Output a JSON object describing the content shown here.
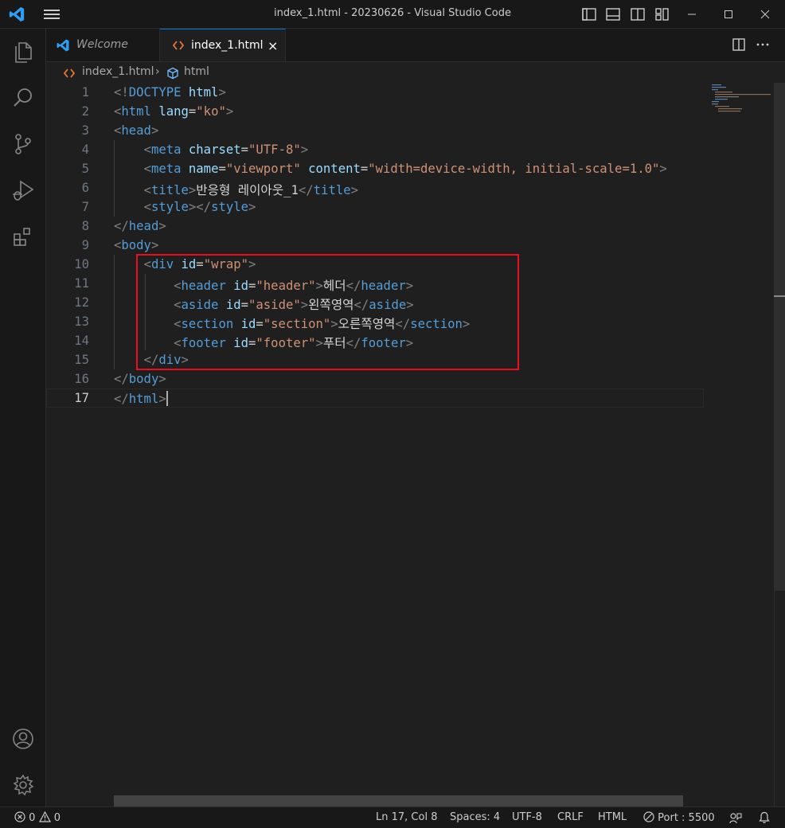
{
  "window": {
    "title": "index_1.html - 20230626 - Visual Studio Code"
  },
  "tabs": [
    {
      "label": "Welcome",
      "active": false
    },
    {
      "label": "index_1.html",
      "active": true,
      "close": "×"
    }
  ],
  "breadcrumb": {
    "file": "index_1.html",
    "separator": "›",
    "symbol": "html"
  },
  "editor": {
    "line_numbers": [
      "1",
      "2",
      "3",
      "4",
      "5",
      "6",
      "7",
      "8",
      "9",
      "10",
      "11",
      "12",
      "13",
      "14",
      "15",
      "16",
      "17"
    ],
    "active_line": "17",
    "lines": [
      [
        [
          "br",
          "<!"
        ],
        [
          "tag",
          "DOCTYPE"
        ],
        [
          "txt",
          " "
        ],
        [
          "attr",
          "html"
        ],
        [
          "br",
          ">"
        ]
      ],
      [
        [
          "br",
          "<"
        ],
        [
          "tag",
          "html"
        ],
        [
          "txt",
          " "
        ],
        [
          "attr",
          "lang"
        ],
        [
          "eq",
          "="
        ],
        [
          "str",
          "\"ko\""
        ],
        [
          "br",
          ">"
        ]
      ],
      [
        [
          "br",
          "<"
        ],
        [
          "tag",
          "head"
        ],
        [
          "br",
          ">"
        ]
      ],
      [
        [
          "txt",
          "    "
        ],
        [
          "br",
          "<"
        ],
        [
          "tag",
          "meta"
        ],
        [
          "txt",
          " "
        ],
        [
          "attr",
          "charset"
        ],
        [
          "eq",
          "="
        ],
        [
          "str",
          "\"UTF-8\""
        ],
        [
          "br",
          ">"
        ]
      ],
      [
        [
          "txt",
          "    "
        ],
        [
          "br",
          "<"
        ],
        [
          "tag",
          "meta"
        ],
        [
          "txt",
          " "
        ],
        [
          "attr",
          "name"
        ],
        [
          "eq",
          "="
        ],
        [
          "str",
          "\"viewport\""
        ],
        [
          "txt",
          " "
        ],
        [
          "attr",
          "content"
        ],
        [
          "eq",
          "="
        ],
        [
          "str",
          "\"width=device-width, initial-scale=1.0\""
        ],
        [
          "br",
          ">"
        ]
      ],
      [
        [
          "txt",
          "    "
        ],
        [
          "br",
          "<"
        ],
        [
          "tag",
          "title"
        ],
        [
          "br",
          ">"
        ],
        [
          "txt",
          "반응형 레이아웃_1"
        ],
        [
          "br",
          "</"
        ],
        [
          "tag",
          "title"
        ],
        [
          "br",
          ">"
        ]
      ],
      [
        [
          "txt",
          "    "
        ],
        [
          "br",
          "<"
        ],
        [
          "tag",
          "style"
        ],
        [
          "br",
          "></"
        ],
        [
          "tag",
          "style"
        ],
        [
          "br",
          ">"
        ]
      ],
      [
        [
          "br",
          "</"
        ],
        [
          "tag",
          "head"
        ],
        [
          "br",
          ">"
        ]
      ],
      [
        [
          "br",
          "<"
        ],
        [
          "tag",
          "body"
        ],
        [
          "br",
          ">"
        ]
      ],
      [
        [
          "txt",
          "    "
        ],
        [
          "br",
          "<"
        ],
        [
          "tag",
          "div"
        ],
        [
          "txt",
          " "
        ],
        [
          "attr",
          "id"
        ],
        [
          "eq",
          "="
        ],
        [
          "str",
          "\"wrap\""
        ],
        [
          "br",
          ">"
        ]
      ],
      [
        [
          "txt",
          "        "
        ],
        [
          "br",
          "<"
        ],
        [
          "tag",
          "header"
        ],
        [
          "txt",
          " "
        ],
        [
          "attr",
          "id"
        ],
        [
          "eq",
          "="
        ],
        [
          "str",
          "\"header\""
        ],
        [
          "br",
          ">"
        ],
        [
          "txt",
          "헤더"
        ],
        [
          "br",
          "</"
        ],
        [
          "tag",
          "header"
        ],
        [
          "br",
          ">"
        ]
      ],
      [
        [
          "txt",
          "        "
        ],
        [
          "br",
          "<"
        ],
        [
          "tag",
          "aside"
        ],
        [
          "txt",
          " "
        ],
        [
          "attr",
          "id"
        ],
        [
          "eq",
          "="
        ],
        [
          "str",
          "\"aside\""
        ],
        [
          "br",
          ">"
        ],
        [
          "txt",
          "왼쪽영역"
        ],
        [
          "br",
          "</"
        ],
        [
          "tag",
          "aside"
        ],
        [
          "br",
          ">"
        ]
      ],
      [
        [
          "txt",
          "        "
        ],
        [
          "br",
          "<"
        ],
        [
          "tag",
          "section"
        ],
        [
          "txt",
          " "
        ],
        [
          "attr",
          "id"
        ],
        [
          "eq",
          "="
        ],
        [
          "str",
          "\"section\""
        ],
        [
          "br",
          ">"
        ],
        [
          "txt",
          "오른쪽영역"
        ],
        [
          "br",
          "</"
        ],
        [
          "tag",
          "section"
        ],
        [
          "br",
          ">"
        ]
      ],
      [
        [
          "txt",
          "        "
        ],
        [
          "br",
          "<"
        ],
        [
          "tag",
          "footer"
        ],
        [
          "txt",
          " "
        ],
        [
          "attr",
          "id"
        ],
        [
          "eq",
          "="
        ],
        [
          "str",
          "\"footer\""
        ],
        [
          "br",
          ">"
        ],
        [
          "txt",
          "푸터"
        ],
        [
          "br",
          "</"
        ],
        [
          "tag",
          "footer"
        ],
        [
          "br",
          ">"
        ]
      ],
      [
        [
          "txt",
          "    "
        ],
        [
          "br",
          "</"
        ],
        [
          "tag",
          "div"
        ],
        [
          "br",
          ">"
        ]
      ],
      [
        [
          "br",
          "</"
        ],
        [
          "tag",
          "body"
        ],
        [
          "br",
          ">"
        ]
      ],
      [
        [
          "br",
          "</"
        ],
        [
          "tag",
          "html"
        ],
        [
          "br",
          ">"
        ]
      ]
    ]
  },
  "activity_bar": [
    "explorer-icon",
    "search-icon",
    "source-control-icon",
    "run-debug-icon",
    "extensions-icon",
    "account-icon",
    "manage-gear-icon"
  ],
  "statusbar": {
    "errors": "0",
    "warnings": "0",
    "position": "Ln 17, Col 8",
    "spaces": "Spaces: 4",
    "encoding": "UTF-8",
    "eol": "CRLF",
    "language": "HTML",
    "port": "Port : 5500"
  },
  "colors": {
    "accent": "#0078d4",
    "highlight_box": "#e81123",
    "tag": "#569cd6",
    "attribute": "#9cdcfe",
    "string": "#ce9178"
  }
}
